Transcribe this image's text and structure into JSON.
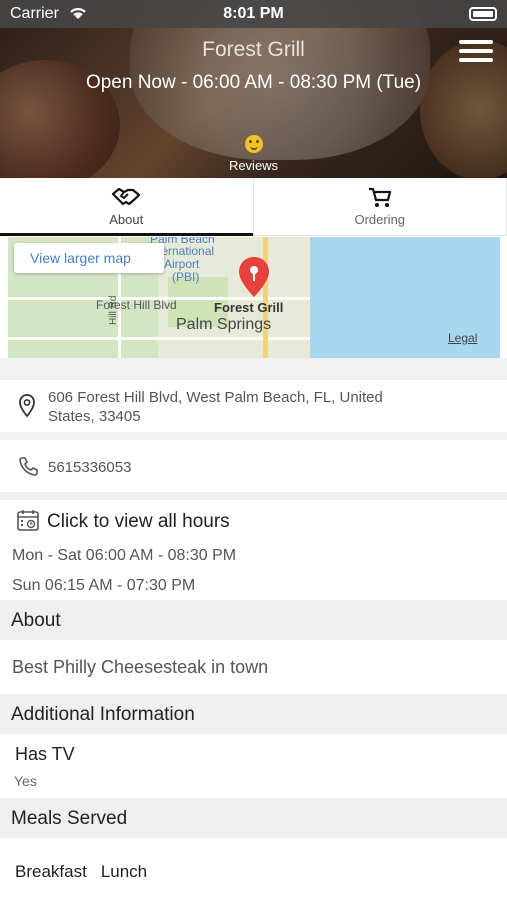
{
  "status_bar": {
    "carrier": "Carrier",
    "time": "8:01 PM"
  },
  "header": {
    "restaurant_name": "Forest Grill",
    "open_status": "Open Now - 06:00 AM - 08:30 PM (Tue)",
    "reviews_label": "Reviews"
  },
  "tabs": [
    {
      "label": "About",
      "icon": "handshake-icon",
      "active": true
    },
    {
      "label": "Ordering",
      "icon": "cart-icon",
      "active": false
    }
  ],
  "map": {
    "view_larger": "View larger map",
    "labels": {
      "palm_beach": "Palm Beach",
      "international": "International",
      "airport": "Airport",
      "pbi": "(PBI)",
      "forest_hill_blvd": "Forest Hill Blvd",
      "pin_name": "Forest Grill",
      "palm_springs": "Palm Springs",
      "hill_rd": "Hill Rd"
    },
    "legal": "Legal"
  },
  "contact": {
    "address": "606 Forest Hill Blvd, West Palm Beach, FL, United States, 33405",
    "phone": "5615336053"
  },
  "hours": {
    "link": "Click to view all hours",
    "lines": [
      "Mon - Sat 06:00 AM - 08:30 PM",
      "Sun 06:15 AM - 07:30 PM"
    ]
  },
  "about": {
    "heading": "About",
    "text": "Best Philly Cheesesteak in town"
  },
  "additional": {
    "heading": "Additional Information",
    "tv_label": "Has TV",
    "tv_value": "Yes"
  },
  "meals": {
    "heading": "Meals Served",
    "items": [
      "Breakfast",
      "Lunch"
    ]
  },
  "colors": {
    "pin": "#e8413c",
    "active_tab_underline": "#111111",
    "map_link": "#4a7fbf"
  }
}
